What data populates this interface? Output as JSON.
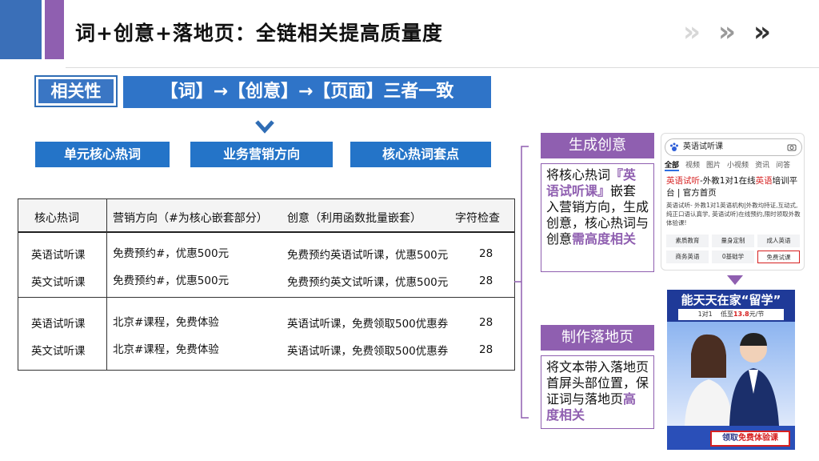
{
  "header": {
    "title": "词+创意+落地页：全链相关提高质量度",
    "chevron_colors": [
      "#d7d7d7",
      "#9a9a9a",
      "#333333"
    ]
  },
  "relevance": {
    "tag": "相关性",
    "chain": "【词】→【创意】→【页面】三者一致"
  },
  "pills": [
    "单元核心热词",
    "业务营销方向",
    "核心热词套点"
  ],
  "table": {
    "headers": [
      "核心热词",
      "营销方向（#为核心嵌套部分）",
      "创意（利用函数批量嵌套）",
      "字符检查"
    ],
    "rows": [
      [
        "英语试听课",
        "免费预约#，优惠500元",
        "免费预约英语试听课，优惠500元",
        "28"
      ],
      [
        "英文试听课",
        "免费预约#，优惠500元",
        "免费预约英文试听课，优惠500元",
        "28"
      ],
      [
        "英语试听课",
        "北京#课程，免费体验",
        "英语试听课，免费领取500优惠券",
        "28"
      ],
      [
        "英文试听课",
        "北京#课程，免费体验",
        "英语试听课，免费领取500优惠券",
        "28"
      ]
    ]
  },
  "panels": {
    "gen": {
      "title": "生成创意",
      "t1": "将核心热词",
      "h1": "『英语试听课』",
      "t2": "嵌套入营销方向，生成创意，核心热词与创意",
      "h2": "需高度相关"
    },
    "landing": {
      "title": "制作落地页",
      "t1": "将文本带入落地页首屏头部位置，保证词与落地页",
      "h1": "高度相关"
    }
  },
  "phone1": {
    "search": "英语试听课",
    "tabs": [
      "全部",
      "视频",
      "图片",
      "小视频",
      "资讯",
      "问答"
    ],
    "ad_title_red": "英语试听",
    "ad_title_mid": "-外教1对1在线",
    "ad_title_red2": "英语",
    "ad_title_end": "培训平台 | 官方首页",
    "ad_desc": "英语试听- 外教1对1英语机构|外教均持证,互动式,纯正口语认真学, 英语试听)在线预约,限时领取外教体验课!",
    "buttons": [
      "素质教育",
      "量身定制",
      "成人英语",
      "商务英语",
      "0基础学",
      "免费试课"
    ]
  },
  "phone2": {
    "headline": "能天天在家“留学”",
    "sub_pre": "1对1",
    "sub_low": "低至",
    "sub_price": "13.8",
    "sub_unit": "元/节",
    "cta_pre": "领取",
    "cta_red": "免费体验课"
  },
  "colors": {
    "blue": "#2f74c8",
    "purple": "#8f5fb0",
    "red": "#d62020"
  }
}
